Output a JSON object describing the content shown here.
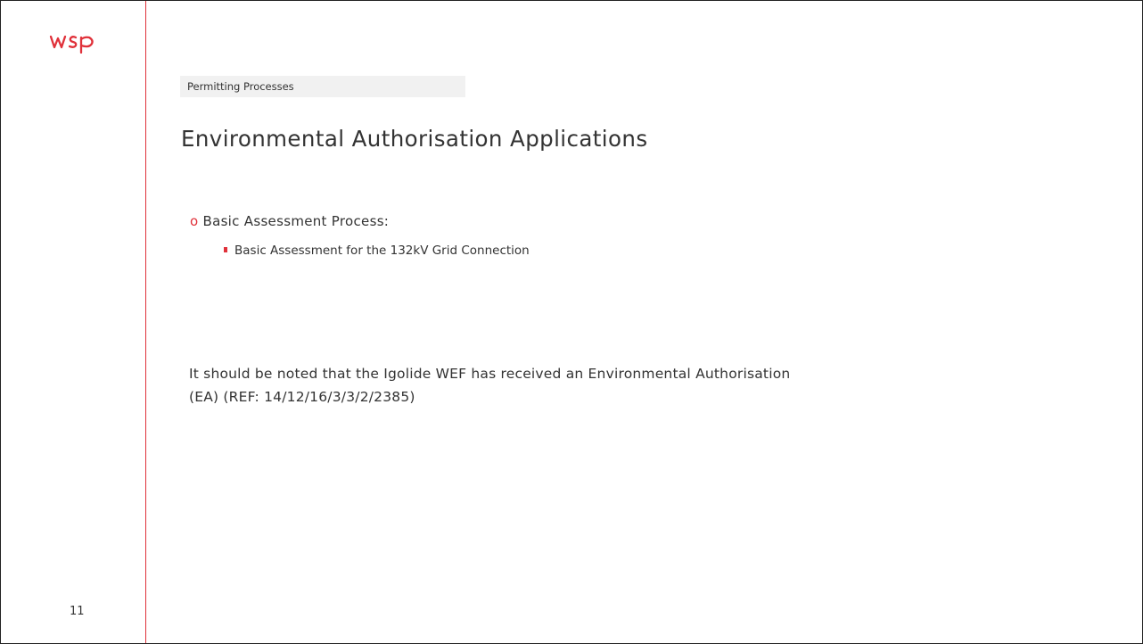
{
  "logo": {
    "text": "wsp",
    "color": "#e0313a"
  },
  "section": {
    "tag": "Permitting Processes"
  },
  "slide": {
    "title": "Environmental Authorisation Applications",
    "bullets": [
      {
        "marker": "o",
        "label": "Basic Assessment Process:",
        "sub_items": [
          "Basic Assessment for the 132kV Grid Connection"
        ]
      }
    ],
    "note_line1": "It should be noted that the Igolide WEF has received an Environmental Authorisation",
    "note_line2": "(EA) (REF: 14/12/16/3/3/2/2385)",
    "page_number": "11"
  },
  "colors": {
    "accent": "#e0313a",
    "text": "#333333",
    "tag_background": "#f1f1f1"
  }
}
